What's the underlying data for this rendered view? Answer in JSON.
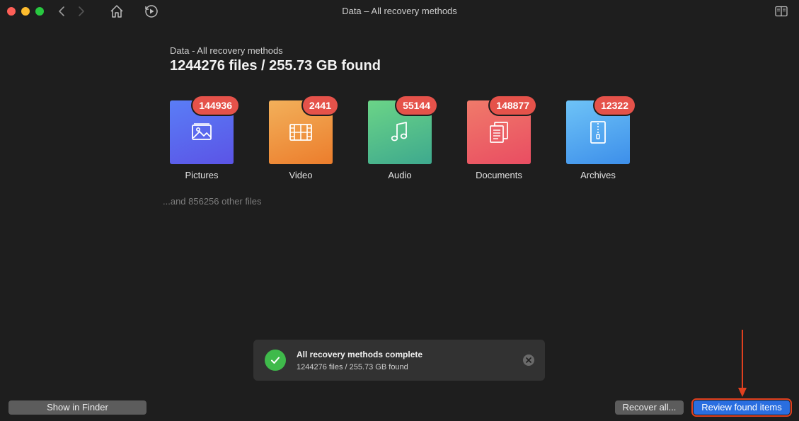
{
  "window": {
    "title": "Data – All recovery methods"
  },
  "header": {
    "subtitle": "Data - All recovery methods",
    "headline": "1244276 files / 255.73 GB found"
  },
  "categories": [
    {
      "label": "Pictures",
      "count": "144936",
      "icon": "picture-icon"
    },
    {
      "label": "Video",
      "count": "2441",
      "icon": "film-icon"
    },
    {
      "label": "Audio",
      "count": "55144",
      "icon": "music-note-icon"
    },
    {
      "label": "Documents",
      "count": "148877",
      "icon": "documents-icon"
    },
    {
      "label": "Archives",
      "count": "12322",
      "icon": "archive-zip-icon"
    }
  ],
  "other_files": "...and 856256 other files",
  "notice": {
    "title": "All recovery methods complete",
    "subtitle": "1244276 files / 255.73 GB found"
  },
  "buttons": {
    "show_in_finder": "Show in Finder",
    "recover_all": "Recover all...",
    "review_found": "Review found items"
  },
  "colors": {
    "accent": "#2a6ee0",
    "badge": "#e5524a",
    "highlight": "#e0401f",
    "success": "#3fba4b"
  }
}
